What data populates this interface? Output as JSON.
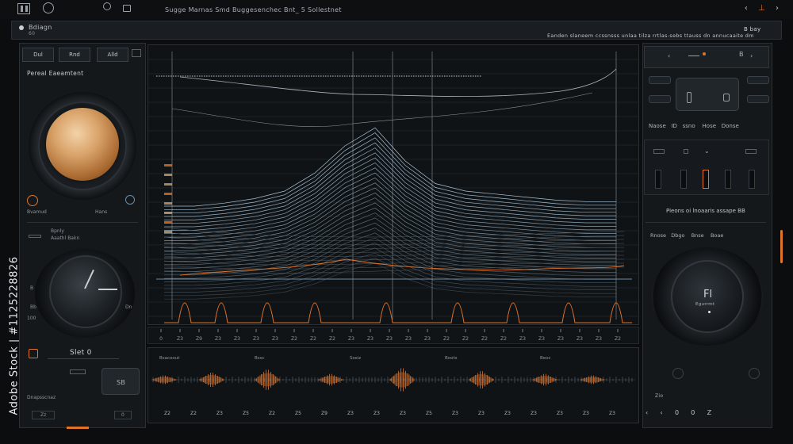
{
  "topbar": {
    "title": "Sugge Marnas    Smd Buggesenchec Bnt_   5 Sollestnet",
    "nav": {
      "prev": "‹",
      "mid": "⊥",
      "next": "›"
    }
  },
  "header": {
    "title": "Bdiagn",
    "subtitle": "60",
    "right_text": "Eanden slaneem ccssnsss unlaa tilza rrtlas-sebs ttauss dn annucaaite dm",
    "button": "B bay"
  },
  "left_panel": {
    "buttons": [
      "Dul",
      "Rnd",
      "Alld"
    ],
    "title": "Pereal Eaeamtent",
    "knob1_caption": "Bvamud",
    "knob1_sub": "Hans",
    "section_label": "Bpnly",
    "section_sub": "Aaathl Bakn",
    "knob2_marks": [
      "B",
      "Bb",
      "Dn",
      "100"
    ],
    "stepper_label": "Slet 0",
    "stepper_value": "SB",
    "footer_left": "Dnapsscnaz",
    "footer_btn1": "Zz",
    "footer_btn2": "0"
  },
  "center": {
    "ticks": [
      "0",
      "Z3",
      "Z9",
      "Z3",
      "Z3",
      "Z3",
      "Z3",
      "Z2",
      "Z2",
      "Z2",
      "Z3",
      "Z3",
      "Z3",
      "Z3",
      "Z3",
      "Z2",
      "Z2",
      "Z2",
      "Z2",
      "Z3",
      "Z3",
      "Z3",
      "Z3",
      "Z3",
      "Z2"
    ],
    "lower_ticks": [
      "2",
      "Z3",
      "Z3",
      "Z5",
      "Z3",
      "Z3",
      "Z5",
      "2",
      "Z3",
      "Z2",
      "Z5",
      "Z3"
    ]
  },
  "wave_panel": {
    "labels": [
      "Bsacoout",
      "Bssc",
      "Sseiz",
      "Boots",
      "Beoc"
    ],
    "bottom_ticks": [
      "Z2",
      "Z2",
      "Z3",
      "Z5",
      "Z2",
      "Z5",
      "Z9",
      "Z3",
      "Z3",
      "Z3",
      "Z5",
      "Z3",
      "Z3",
      "Z3",
      "Z3",
      "Z3",
      "Z3",
      "Z3"
    ]
  },
  "right_panel": {
    "top_label": "B",
    "row1": [
      "Naose",
      "ID",
      "ssno",
      "Hose",
      "Donse"
    ],
    "section2": "Pieons oi lnoaaris assape  BB",
    "row3": [
      "Rnose",
      "Dbgo",
      "Bnse",
      "Boae"
    ],
    "knob_label": "Fl",
    "knob_sub": "Egurrmt",
    "bottom_label": "Zio",
    "bottom_nav": [
      "‹",
      "‹",
      "0",
      "0",
      "Z"
    ]
  },
  "sidebar": {
    "watermark_text": "Adobe Stock | #1125228826"
  },
  "colors": {
    "accent": "#e0742a",
    "wave": "#b9d6ea",
    "panel": "#14181b"
  },
  "chart_data": {
    "type": "line",
    "series": [
      {
        "values": [
          0.3,
          0.3,
          0.32,
          0.35,
          0.4,
          0.52,
          0.7,
          0.82,
          0.6,
          0.45,
          0.4,
          0.38,
          0.36,
          0.34,
          0.33,
          0.33
        ]
      }
    ]
  }
}
